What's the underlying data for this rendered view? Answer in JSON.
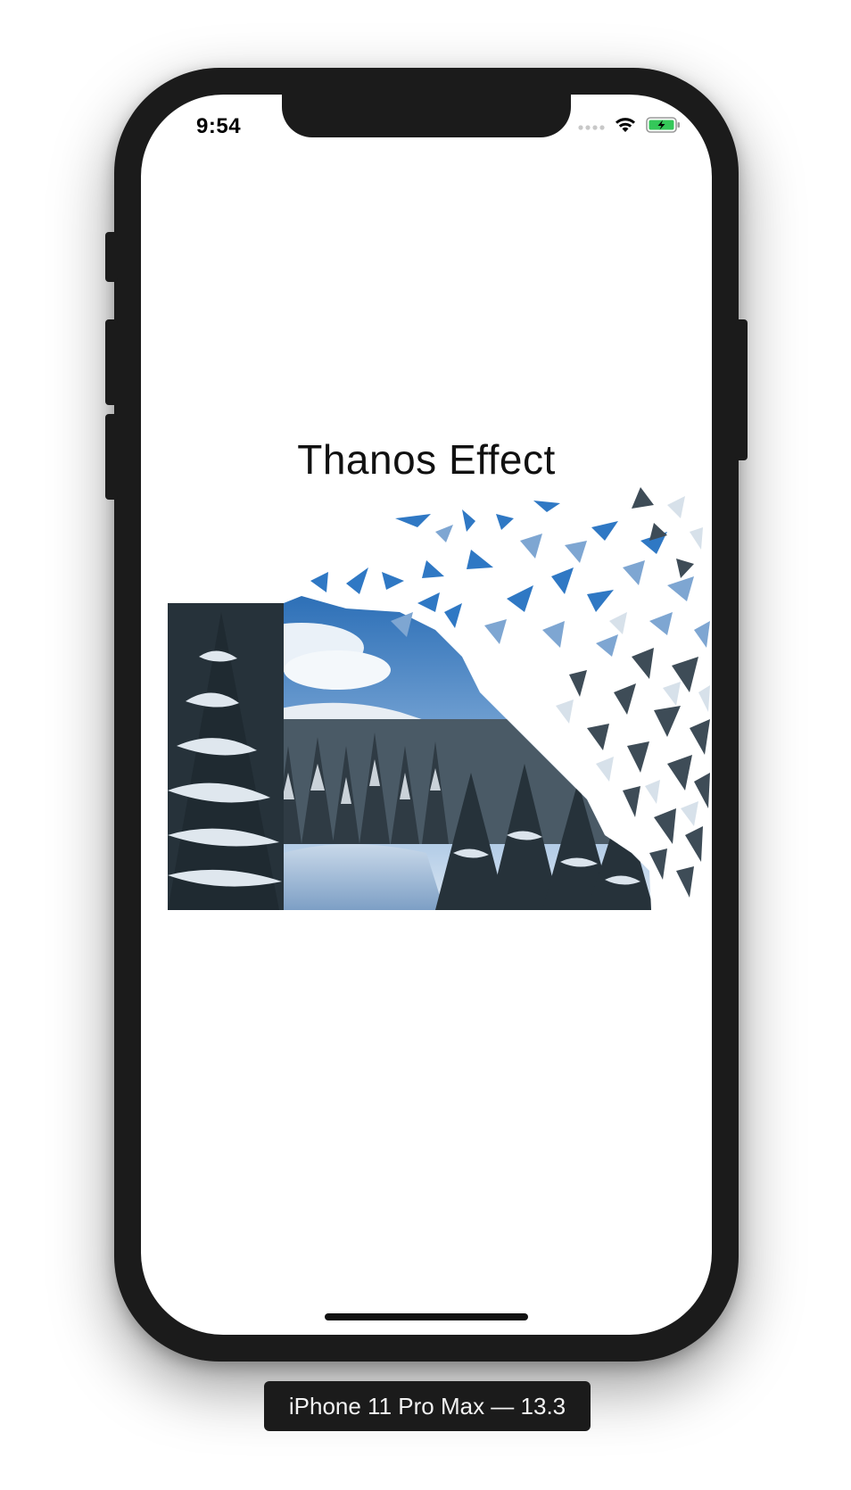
{
  "status_bar": {
    "time": "9:54",
    "signal_icon": "cellular-signal-dots-icon",
    "wifi_icon": "wifi-icon",
    "battery_icon": "battery-charging-icon",
    "battery_color": "#34c759"
  },
  "app": {
    "title": "Thanos Effect",
    "image_icon": "snowy-forest-photo"
  },
  "device": {
    "label": "iPhone 11 Pro Max — 13.3"
  }
}
